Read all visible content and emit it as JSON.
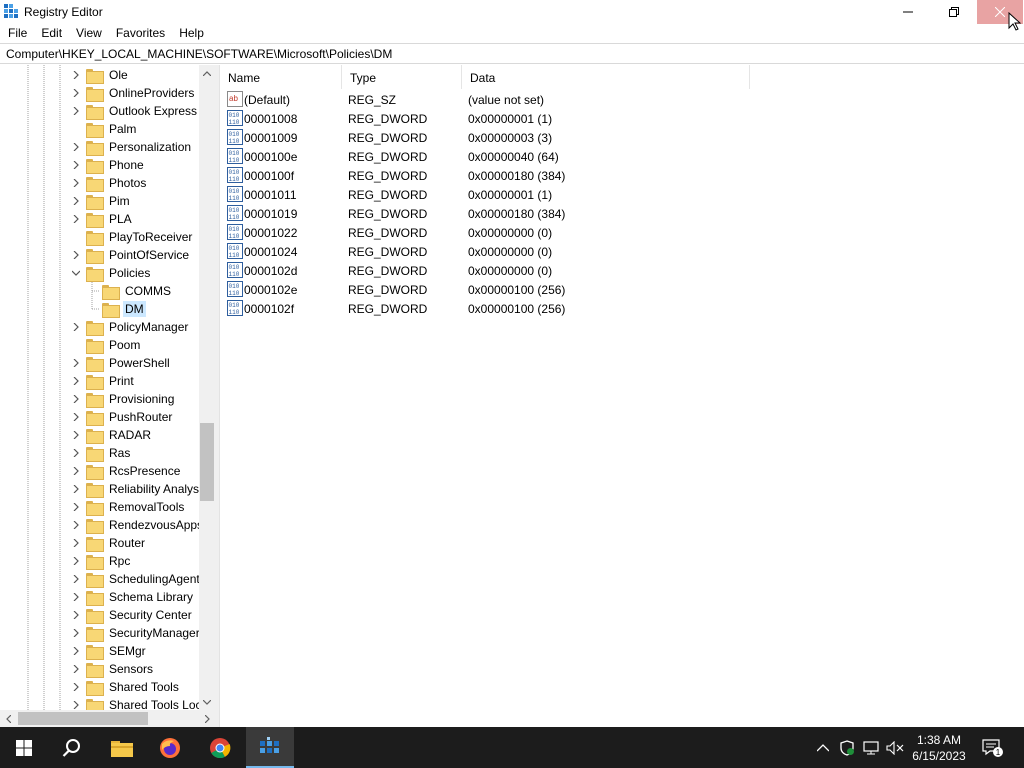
{
  "window": {
    "title": "Registry Editor",
    "minimize_icon": "minimize-icon",
    "restore_icon": "restore-icon",
    "close_icon": "close-icon"
  },
  "menu": [
    "File",
    "Edit",
    "View",
    "Favorites",
    "Help"
  ],
  "address": "Computer\\HKEY_LOCAL_MACHINE\\SOFTWARE\\Microsoft\\Policies\\DM",
  "tree": [
    {
      "label": "Ole",
      "depth": 0,
      "chevron": "right"
    },
    {
      "label": "OnlineProviders",
      "depth": 0,
      "chevron": "right"
    },
    {
      "label": "Outlook Express",
      "depth": 0,
      "chevron": "right"
    },
    {
      "label": "Palm",
      "depth": 0,
      "chevron": "none"
    },
    {
      "label": "Personalization",
      "depth": 0,
      "chevron": "right"
    },
    {
      "label": "Phone",
      "depth": 0,
      "chevron": "right"
    },
    {
      "label": "Photos",
      "depth": 0,
      "chevron": "right"
    },
    {
      "label": "Pim",
      "depth": 0,
      "chevron": "right"
    },
    {
      "label": "PLA",
      "depth": 0,
      "chevron": "right"
    },
    {
      "label": "PlayToReceiver",
      "depth": 0,
      "chevron": "none"
    },
    {
      "label": "PointOfService",
      "depth": 0,
      "chevron": "right"
    },
    {
      "label": "Policies",
      "depth": 0,
      "chevron": "down"
    },
    {
      "label": "COMMS",
      "depth": 1,
      "chevron": "none"
    },
    {
      "label": "DM",
      "depth": 1,
      "chevron": "none",
      "selected": true
    },
    {
      "label": "PolicyManager",
      "depth": 0,
      "chevron": "right"
    },
    {
      "label": "Poom",
      "depth": 0,
      "chevron": "none"
    },
    {
      "label": "PowerShell",
      "depth": 0,
      "chevron": "right"
    },
    {
      "label": "Print",
      "depth": 0,
      "chevron": "right"
    },
    {
      "label": "Provisioning",
      "depth": 0,
      "chevron": "right"
    },
    {
      "label": "PushRouter",
      "depth": 0,
      "chevron": "right"
    },
    {
      "label": "RADAR",
      "depth": 0,
      "chevron": "right"
    },
    {
      "label": "Ras",
      "depth": 0,
      "chevron": "right"
    },
    {
      "label": "RcsPresence",
      "depth": 0,
      "chevron": "right"
    },
    {
      "label": "Reliability Analysi",
      "depth": 0,
      "chevron": "right"
    },
    {
      "label": "RemovalTools",
      "depth": 0,
      "chevron": "right"
    },
    {
      "label": "RendezvousApps",
      "depth": 0,
      "chevron": "right"
    },
    {
      "label": "Router",
      "depth": 0,
      "chevron": "right"
    },
    {
      "label": "Rpc",
      "depth": 0,
      "chevron": "right"
    },
    {
      "label": "SchedulingAgent",
      "depth": 0,
      "chevron": "right"
    },
    {
      "label": "Schema Library",
      "depth": 0,
      "chevron": "right"
    },
    {
      "label": "Security Center",
      "depth": 0,
      "chevron": "right"
    },
    {
      "label": "SecurityManager",
      "depth": 0,
      "chevron": "right"
    },
    {
      "label": "SEMgr",
      "depth": 0,
      "chevron": "right"
    },
    {
      "label": "Sensors",
      "depth": 0,
      "chevron": "right"
    },
    {
      "label": "Shared Tools",
      "depth": 0,
      "chevron": "right"
    },
    {
      "label": "Shared Tools Loca",
      "depth": 0,
      "chevron": "right"
    }
  ],
  "columns": {
    "name": "Name",
    "type": "Type",
    "data": "Data"
  },
  "values": [
    {
      "name": "(Default)",
      "type": "REG_SZ",
      "data": "(value not set)",
      "icon": "string-value-icon"
    },
    {
      "name": "00001008",
      "type": "REG_DWORD",
      "data": "0x00000001 (1)",
      "icon": "binary-value-icon"
    },
    {
      "name": "00001009",
      "type": "REG_DWORD",
      "data": "0x00000003 (3)",
      "icon": "binary-value-icon"
    },
    {
      "name": "0000100e",
      "type": "REG_DWORD",
      "data": "0x00000040 (64)",
      "icon": "binary-value-icon"
    },
    {
      "name": "0000100f",
      "type": "REG_DWORD",
      "data": "0x00000180 (384)",
      "icon": "binary-value-icon"
    },
    {
      "name": "00001011",
      "type": "REG_DWORD",
      "data": "0x00000001 (1)",
      "icon": "binary-value-icon"
    },
    {
      "name": "00001019",
      "type": "REG_DWORD",
      "data": "0x00000180 (384)",
      "icon": "binary-value-icon"
    },
    {
      "name": "00001022",
      "type": "REG_DWORD",
      "data": "0x00000000 (0)",
      "icon": "binary-value-icon"
    },
    {
      "name": "00001024",
      "type": "REG_DWORD",
      "data": "0x00000000 (0)",
      "icon": "binary-value-icon"
    },
    {
      "name": "0000102d",
      "type": "REG_DWORD",
      "data": "0x00000000 (0)",
      "icon": "binary-value-icon"
    },
    {
      "name": "0000102e",
      "type": "REG_DWORD",
      "data": "0x00000100 (256)",
      "icon": "binary-value-icon"
    },
    {
      "name": "0000102f",
      "type": "REG_DWORD",
      "data": "0x00000100 (256)",
      "icon": "binary-value-icon"
    }
  ],
  "taskbar": {
    "apps": [
      "start-icon",
      "search-icon",
      "file-explorer-icon",
      "firefox-icon",
      "chrome-icon",
      "registry-editor-icon"
    ],
    "tray": [
      "chevron-up-icon",
      "security-icon",
      "network-icon",
      "volume-muted-icon"
    ],
    "time": "1:38 AM",
    "date": "6/15/2023",
    "notification_count": "1"
  },
  "colors": {
    "selection": "#cce8ff",
    "taskbar": "#1c1c1c",
    "close_hover": "#e8a3a3",
    "accent": "#76b9ed"
  }
}
